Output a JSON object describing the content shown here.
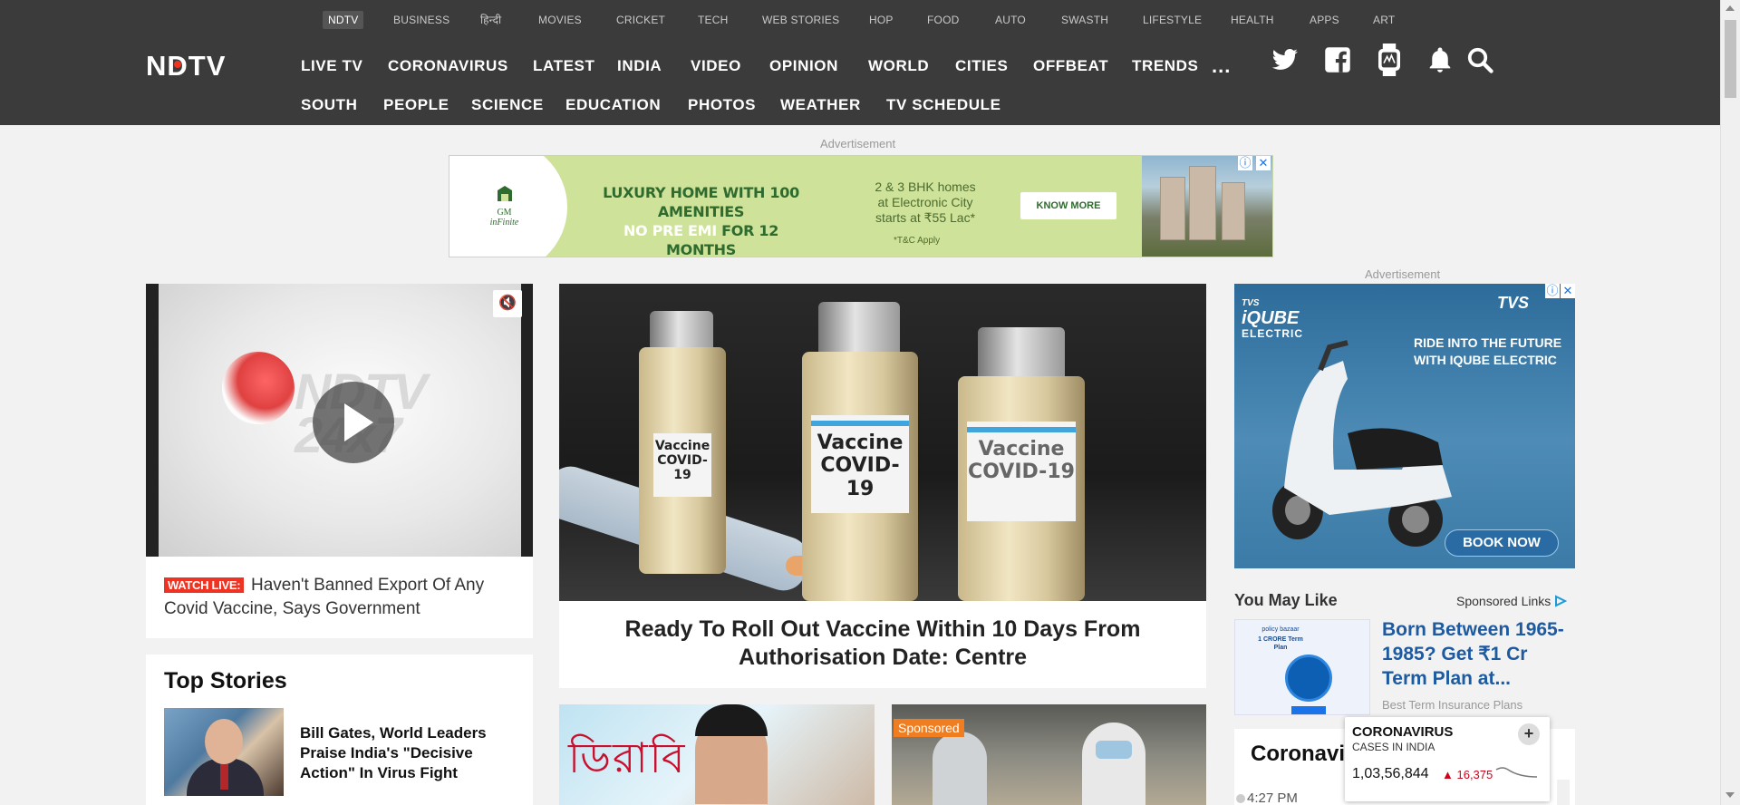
{
  "top_nav": [
    "NDTV",
    "BUSINESS",
    "हिन्दी",
    "MOVIES",
    "CRICKET",
    "TECH",
    "WEB STORIES",
    "HOP",
    "FOOD",
    "AUTO",
    "SWASTH",
    "LIFESTYLE",
    "HEALTH",
    "APPS",
    "ART"
  ],
  "logo_text": "NDTV",
  "main_nav": [
    "LIVE TV",
    "CORONAVIRUS",
    "LATEST",
    "INDIA",
    "VIDEO",
    "OPINION",
    "WORLD",
    "CITIES",
    "OFFBEAT",
    "TRENDS"
  ],
  "more_label": "...",
  "sub_nav": [
    "SOUTH",
    "PEOPLE",
    "SCIENCE",
    "EDUCATION",
    "PHOTOS",
    "WEATHER",
    "TV SCHEDULE"
  ],
  "header_icons": [
    "twitter-icon",
    "facebook-icon",
    "smartwatch-icon",
    "bell-icon",
    "search-icon"
  ],
  "ad_label": "Advertisement",
  "banner_ad": {
    "logo_line1": "GM",
    "logo_line2": "inFinite",
    "headline_line1": "LUXURY HOME WITH 100 AMENITIES",
    "headline_white": "NO PRE EMI",
    "headline_line2_rest": " FOR 12 MONTHS",
    "sub_line1": "2 & 3 BHK homes",
    "sub_line2": "at Electronic City",
    "sub_line3": "starts at ₹55 Lac*",
    "tc": "*T&C Apply",
    "cta": "KNOW MORE"
  },
  "video": {
    "watch_live_label": "WATCH LIVE:",
    "title": "Haven't Banned Export Of Any Covid Vaccine, Says Government"
  },
  "top_stories": {
    "heading": "Top Stories",
    "items": [
      {
        "title": "Bill Gates, World Leaders Praise India's \"Decisive Action\" In Virus Fight"
      }
    ]
  },
  "main_story": {
    "title": "Ready To Roll Out Vaccine Within 10 Days From Authorisation Date: Centre",
    "vial_label_1": "Vaccine",
    "vial_label_1b": "COVID-19"
  },
  "tile2": {
    "sponsored_label": "Sponsored"
  },
  "tvs_ad": {
    "brand": "iQUBE",
    "brand_sub": "ELECTRIC",
    "brand_prefix": "TVS",
    "tvs": "TVS",
    "slogan_line1": "RIDE INTO THE FUTURE",
    "slogan_line2": "WITH IQUBE ELECTRIC",
    "cta": "BOOK NOW"
  },
  "you_may_like": {
    "heading": "You May Like",
    "sponsored_links": "Sponsored Links",
    "thumb_line1": "policy bazaar",
    "thumb_line2": "1 CRORE Term Plan",
    "title": "Born Between 1965-1985? Get ₹1 Cr Term Plan at...",
    "source": "Best Term Insurance Plans"
  },
  "coronavirus_box": {
    "title": "Coronavi",
    "time": "4:27 PM"
  },
  "corona_widget": {
    "title": "CORONAVIRUS",
    "subtitle": "CASES IN INDIA",
    "cases": "1,03,56,844",
    "delta": "16,375",
    "expand": "+"
  }
}
